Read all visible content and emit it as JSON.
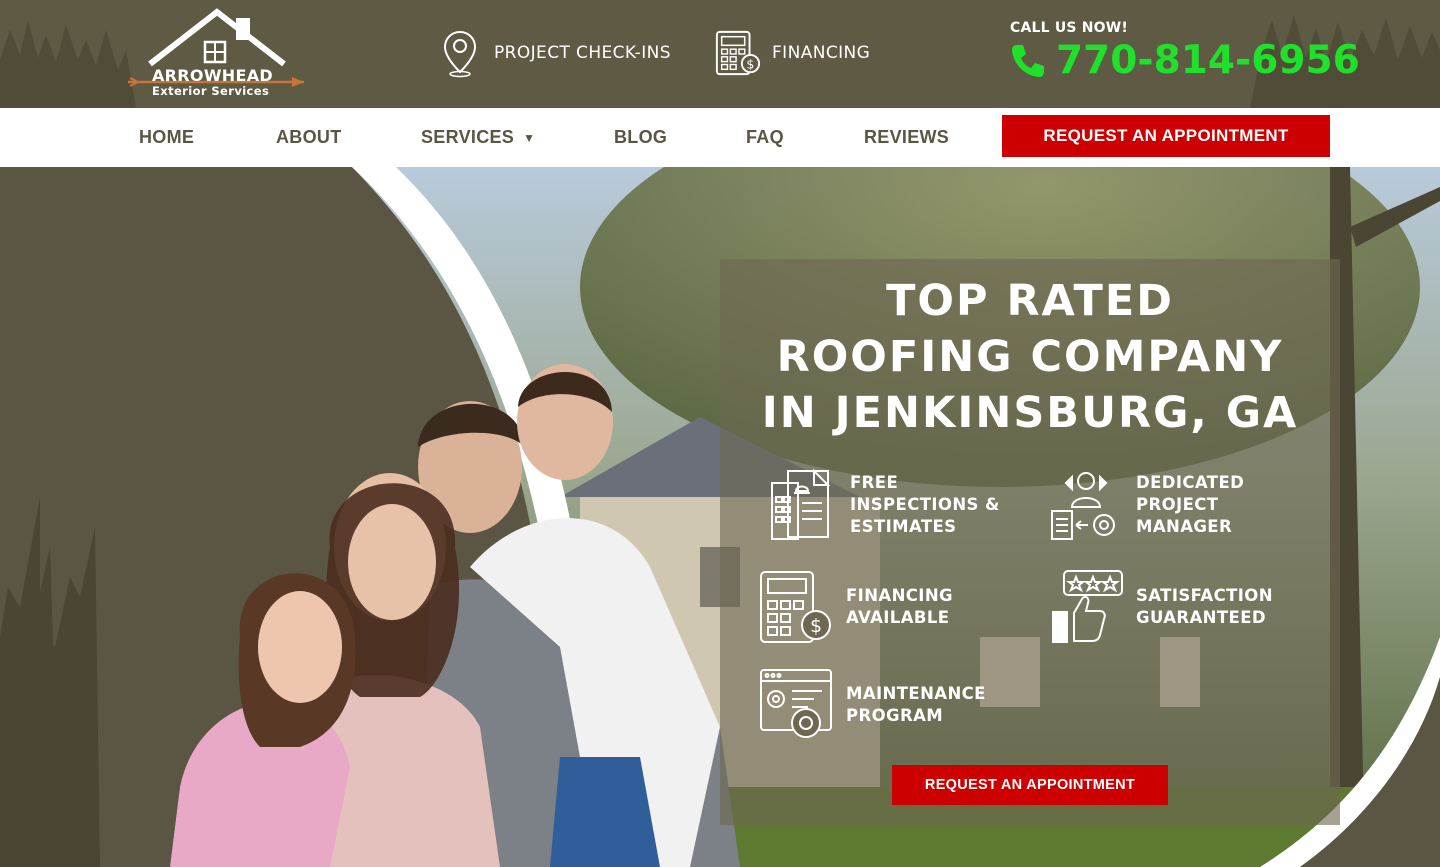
{
  "brand": {
    "name": "ARROWHEAD",
    "subtitle": "Exterior Services",
    "colors": {
      "olive": "#5b5643",
      "red": "#cc0000",
      "phone_green": "#1fe02a"
    }
  },
  "header": {
    "links": [
      {
        "label": "PROJECT CHECK-INS",
        "icon": "location-pin-icon"
      },
      {
        "label": "FINANCING",
        "icon": "calculator-dollar-icon"
      }
    ],
    "call_label": "CALL US NOW!",
    "phone": "770-814-6956"
  },
  "nav": {
    "items": [
      {
        "label": "HOME"
      },
      {
        "label": "ABOUT"
      },
      {
        "label": "SERVICES",
        "caret": "▼"
      },
      {
        "label": "BLOG"
      },
      {
        "label": "FAQ"
      },
      {
        "label": "REVIEWS"
      }
    ],
    "cta": "REQUEST AN APPOINTMENT"
  },
  "hero": {
    "title_lines": [
      "TOP RATED",
      "ROOFING COMPANY",
      "IN JENKINSBURG, GA"
    ],
    "features": [
      {
        "text": "FREE\nINSPECTIONS &\nESTIMATES",
        "icon": "inspection-clipboard-icon"
      },
      {
        "text": "DEDICATED\nPROJECT\nMANAGER",
        "icon": "project-manager-icon"
      },
      {
        "text": "FINANCING\nAVAILABLE",
        "icon": "calculator-dollar-icon"
      },
      {
        "text": "SATISFACTION\nGUARANTEED",
        "icon": "thumbs-up-stars-icon"
      },
      {
        "text": "MAINTENANCE\nPROGRAM",
        "icon": "maintenance-gear-icon"
      }
    ],
    "cta": "REQUEST AN APPOINTMENT"
  }
}
